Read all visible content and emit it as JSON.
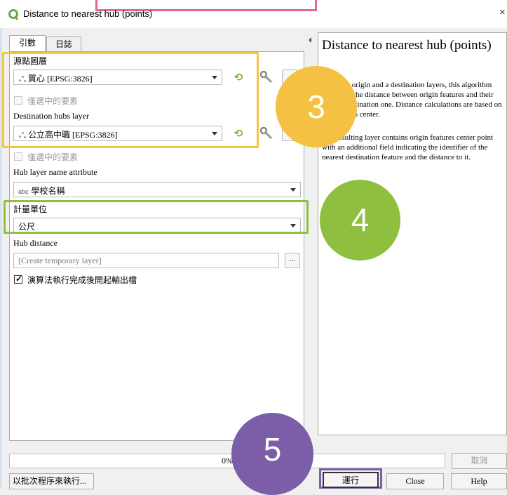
{
  "window": {
    "title": "Distance to nearest hub (points)",
    "close_glyph": "×"
  },
  "tabs": [
    {
      "label": "引數"
    },
    {
      "label": "日誌"
    }
  ],
  "params": {
    "source_label": "源點圖層",
    "source_value": "質心 [EPSG:3826]",
    "source_selected_only": "僅選中的要素",
    "dest_label": "Destination hubs layer",
    "dest_value": "公立高中職 [EPSG:3826]",
    "dest_selected_only": "僅選中的要素",
    "hub_attr_label": "Hub layer name attribute",
    "hub_attr_prefix": "abc",
    "hub_attr_value": "學校名稱",
    "unit_label": "計量單位",
    "unit_value": "公尺",
    "hub_distance_label": "Hub distance",
    "hub_distance_placeholder": "[Create temporary layer]",
    "browse_label": "...",
    "open_output_label": "演算法執行完成後開起輸出檔",
    "open_output_checked": true
  },
  "help": {
    "title": "Distance to nearest hub (points)",
    "p1": "Given an origin and a destination layers, this algorithm computes the distance between origin features and their closest destination one. Distance calculations are based on the features center.",
    "p2": "The resulting layer contains origin features center point with an additional field indicating the identifier of the nearest destination feature and the distance to it."
  },
  "footer": {
    "progress_text": "0%",
    "progress_value": 0,
    "cancel_label": "取消",
    "batch_label": "以批次程序來執行...",
    "run_label": "運行",
    "close_label": "Close",
    "help_label": "Help"
  },
  "annotations": {
    "step3": "3",
    "step4": "4",
    "step5": "5",
    "color_yellow": "#f4c142",
    "color_green": "#8fbf3f",
    "color_purple": "#7b5ea7",
    "color_pink": "#e5659b"
  }
}
